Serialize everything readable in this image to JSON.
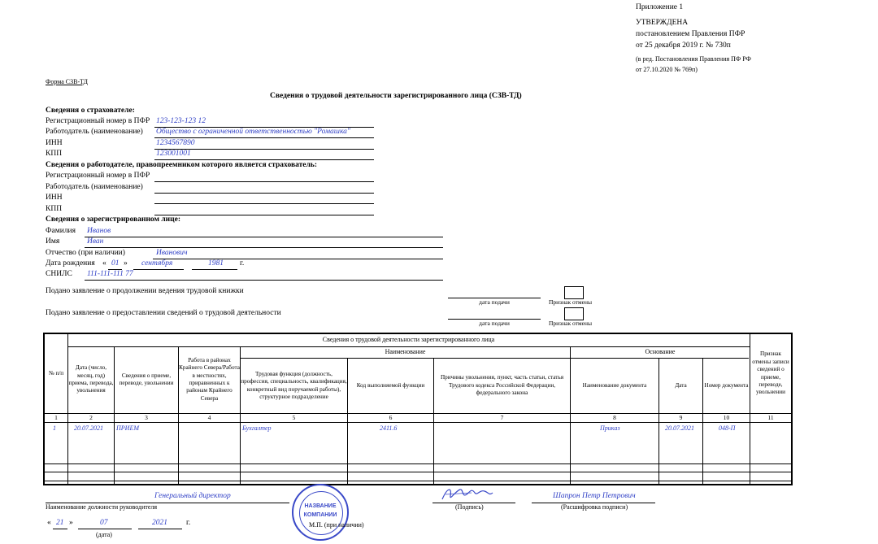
{
  "header": {
    "appendix": "Приложение 1",
    "approved": "УТВЕРЖДЕНА",
    "decree": "постановлением Правления ПФР",
    "decree_date": "от 25 декабря 2019 г. № 730п",
    "edition": "(в ред. Постановления Правления ПФ РФ",
    "edition_date": "от 27.10.2020 № 769п)"
  },
  "form_name": "Форма СЗВ-ТД",
  "title": "Сведения о трудовой деятельности зарегистрированного лица (СЗВ-ТД)",
  "insurer": {
    "heading": "Сведения о страхователе:",
    "reg_label": "Регистрационный номер в ПФР",
    "reg_value": "123-123-123 12",
    "employer_label": "Работодатель (наименование)",
    "employer_value": "Общество с ограниченной ответственностью \"Ромашка\"",
    "inn_label": "ИНН",
    "inn_value": "1234567890",
    "kpp_label": "КПП",
    "kpp_value": "123001001"
  },
  "successor": {
    "heading": "Сведения о работодателе, правопреемником которого является страхователь:",
    "reg_label": "Регистрационный номер в ПФР",
    "employer_label": "Работодатель (наименование)",
    "inn_label": "ИНН",
    "kpp_label": "КПП"
  },
  "person": {
    "heading": "Сведения о зарегистрированном лице:",
    "surname_label": "Фамилия",
    "surname_value": "Иванов",
    "name_label": "Имя",
    "name_value": "Иван",
    "patronymic_label": "Отчество (при наличии)",
    "patronymic_value": "Иванович",
    "birth_label": "Дата рождения",
    "birth_open": "«",
    "birth_day": "01",
    "birth_close": "»",
    "birth_month": "сентября",
    "birth_year": "1981",
    "birth_suffix": "г.",
    "snils_label": "СНИЛС",
    "snils_value": "111-111-111 77"
  },
  "applications": {
    "book_text": "Подано заявление о продолжении ведения трудовой книжки",
    "info_text": "Подано заявление о предоставлении сведений о трудовой деятельности",
    "date_caption": "дата подачи",
    "cancel_caption": "Признак отмены"
  },
  "table": {
    "main_header": "Сведения о трудовой деятельности зарегистрированного лица",
    "col_num": "№ п/п",
    "col_date": "Дата (число, месяц, год) приема, перевода, увольнения",
    "col_info": "Сведения о приеме, переводе, увольнении",
    "col_north": "Работа в районах Крайнего Севера/Работа в местностях, приравненных к районам Крайнего Севера",
    "naming_header": "Наименование",
    "col_function": "Трудовая функция (должность, профессия, специальность, квалификация, конкретный вид поручаемой работы), структурное подразделение",
    "col_code": "Код выполняемой функции",
    "col_reasons": "Причины увольнения, пункт, часть статьи, статья Трудового кодекса Российской Федерации, федерального закона",
    "basis_header": "Основание",
    "col_docname": "Наименование документа",
    "col_docdate": "Дата",
    "col_docnum": "Номер документа",
    "col_cancel": "Признак отмены записи сведений о приеме, переводе, увольнении",
    "numbers": [
      "1",
      "2",
      "3",
      "4",
      "5",
      "6",
      "7",
      "8",
      "9",
      "10",
      "11"
    ],
    "row": {
      "num": "1",
      "date": "20.07.2021",
      "info": "ПРИЕМ",
      "function": "Бухгалтер",
      "code": "2411.6",
      "docname": "Приказ",
      "docdate": "20.07.2021",
      "docnum": "048-П"
    }
  },
  "signature": {
    "position_value": "Генеральный директор",
    "position_label": "Наименование должности руководителя",
    "sign_label": "(Подпись)",
    "decode_value": "Шапрон Петр Петрович",
    "decode_label": "(Расшифровка подписи)",
    "date_open": "«",
    "date_day": "21",
    "date_close": "»",
    "date_month": "07",
    "date_year": "2021",
    "date_suffix": "г.",
    "date_label": "(дата)",
    "mp_label": "М.П. (при наличии)",
    "stamp_line1": "НАЗВАНИЕ",
    "stamp_line2": "КОМПАНИИ"
  },
  "colors": {
    "filled_text": "#2f3fc6",
    "stamp": "#3a49c8"
  }
}
